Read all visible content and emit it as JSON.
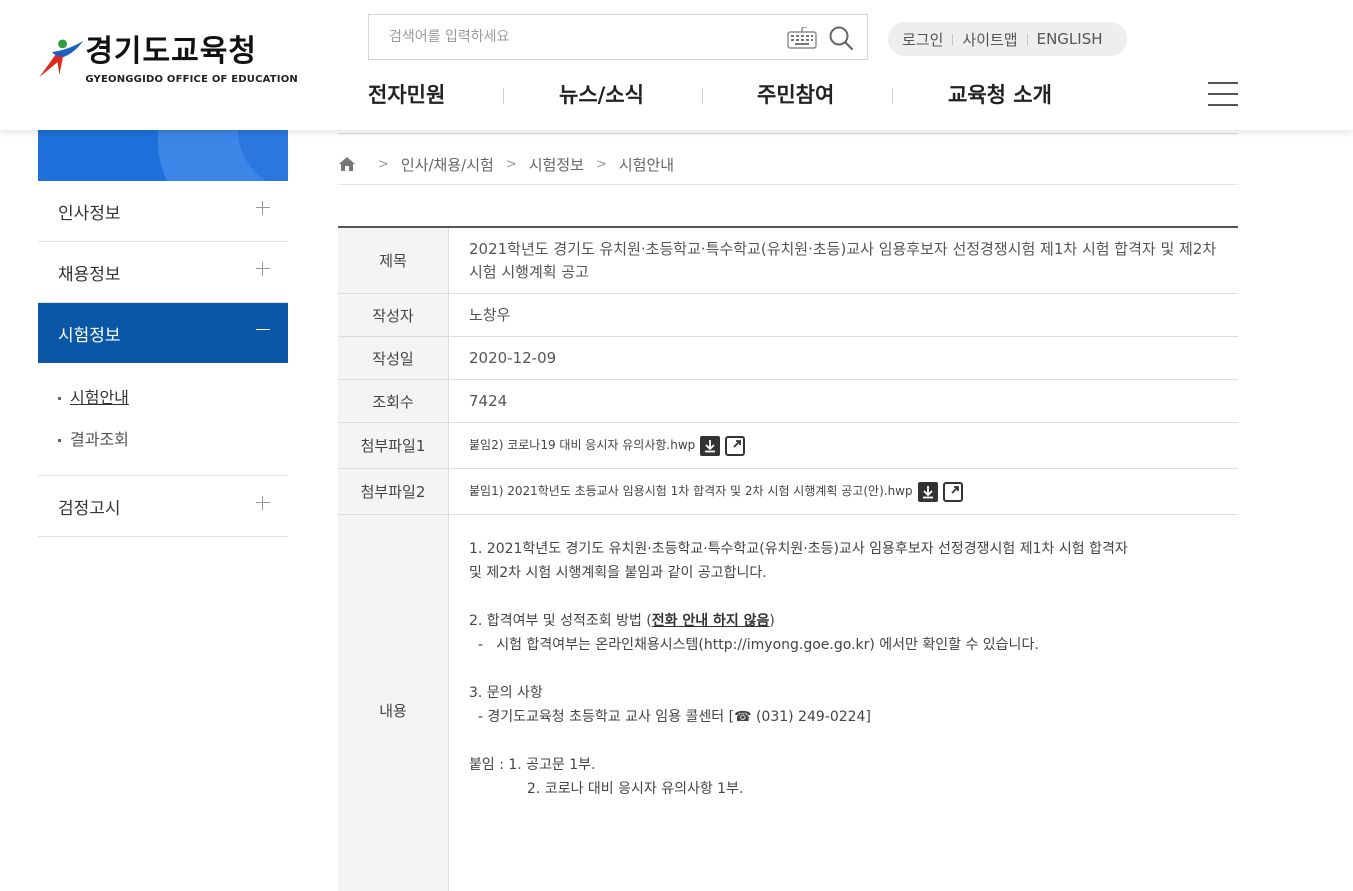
{
  "header": {
    "logo_title": "경기도교육청",
    "logo_sub": "GYEONGGIDO OFFICE OF EDUCATION",
    "search_placeholder": "검색어를 입력하세요",
    "util_links": [
      "로그인",
      "사이트맵",
      "ENGLISH"
    ],
    "gnb": [
      "전자민원",
      "뉴스/소식",
      "주민참여",
      "교육청 소개"
    ]
  },
  "sidebar": {
    "items": [
      {
        "label": "인사정보"
      },
      {
        "label": "채용정보"
      },
      {
        "label": "시험정보",
        "active": true
      }
    ],
    "sub_items": [
      "시험안내",
      "결과조회"
    ],
    "last_item": "검정고시"
  },
  "breadcrumb": [
    "인사/채용/시험",
    "시험정보",
    "시험안내"
  ],
  "post": {
    "labels": {
      "title": "제목",
      "author": "작성자",
      "date": "작성일",
      "views": "조회수",
      "file1": "첨부파일1",
      "file2": "첨부파일2",
      "content": "내용"
    },
    "title": "2021학년도 경기도 유치원·초등학교·특수학교(유치원·초등)교사 임용후보자 선정경쟁시험 제1차 시험 합격자 및 제2차 시험 시행계획 공고",
    "author": "노창우",
    "date": "2020-12-09",
    "views": "7424",
    "file1": "붙임2) 코로나19 대비 응시자 유의사항.hwp",
    "file2": "붙임1) 2021학년도 초등교사 임용시험 1차 합격자 및 2차 시험 시행계획 공고(안).hwp",
    "content": {
      "p1a": "1. 2021학년도 경기도 유치원·초등학교·특수학교(유치원·초등)교사 임용후보자 선정경쟁시험 제1차 시험 합격자",
      "p1b": "및 제2차 시험 시행계획을 붙임과 같이 공고합니다.",
      "p2_prefix": "2. 합격여부 및 성적조회 방법 (",
      "p2_bold": "전화 안내 하지 않음",
      "p2_suffix": ")",
      "p2_line": "  -   시험 합격여부는 온라인채용시스템(http://imyong.goe.go.kr) 에서만 확인할 수 있습니다.",
      "p3": "3. 문의 사항",
      "p3_line": "  - 경기도교육청 초등학교 교사 임용 콜센터 [☎ (031) 249-0224]",
      "att1": "붙임 : 1. 공고문 1부.",
      "att2": "2. 코로나 대비 응시자 유의사항 1부."
    }
  },
  "colors": {
    "lnb_active": "#0a57a8",
    "lnb_banner": "#1e6fd9",
    "logo_red": "#e1261c",
    "logo_blue": "#1f5fbf",
    "logo_green": "#2f9e3f"
  }
}
